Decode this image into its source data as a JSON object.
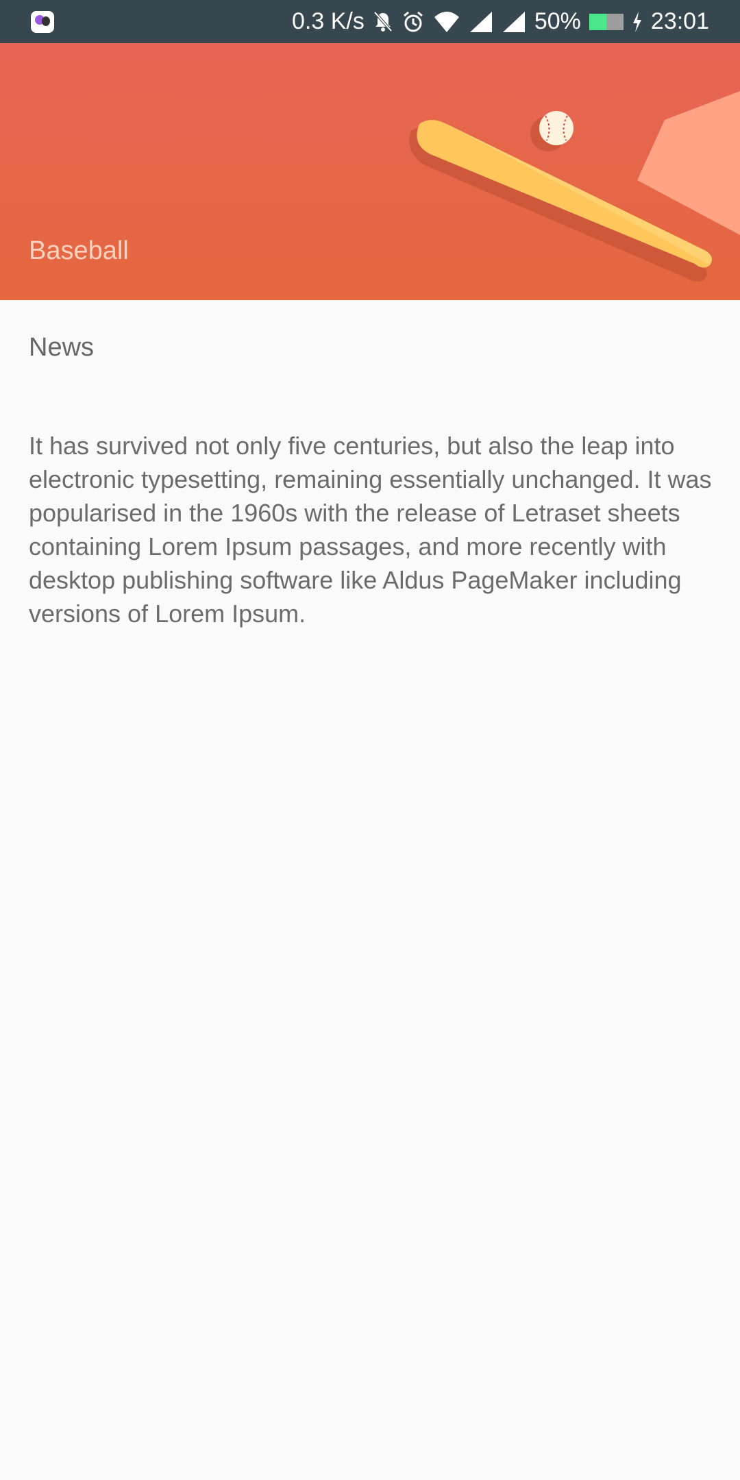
{
  "status_bar": {
    "speed": "0.3 K/s",
    "battery_percent": "50%",
    "battery_level": 0.5,
    "time": "23:01",
    "icons": [
      "app-icon",
      "bell-off-icon",
      "alarm-icon",
      "wifi-icon",
      "signal-icon",
      "signal-icon",
      "battery-icon",
      "charging-icon"
    ]
  },
  "header": {
    "title": "Baseball",
    "background_color": "#e66555",
    "illustration": "baseball-bat-and-ball"
  },
  "content": {
    "section_title": "News",
    "body": "It has survived not only five centuries, but also the leap into electronic typesetting, remaining essentially unchanged. It was popularised in the 1960s with the release of Letraset sheets containing Lorem Ipsum passages, and more recently with desktop publishing software like Aldus PageMaker including versions of Lorem Ipsum."
  }
}
